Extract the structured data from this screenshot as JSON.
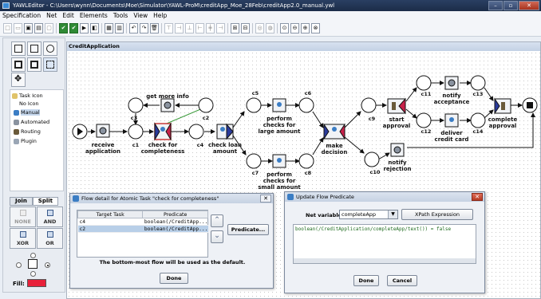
{
  "window": {
    "title": "YAWLEditor - C:\\Users\\wynn\\Documents\\Moe\\Simulator\\YAWL-ProM\\creditApp_Moe_28Feb\\creditApp2.0_manual.ywl"
  },
  "menu": [
    "Specification",
    "Net",
    "Edit",
    "Elements",
    "Tools",
    "View",
    "Help"
  ],
  "canvas": {
    "net_name": "CreditApplication"
  },
  "palette": {
    "tree": [
      "Task Icon",
      "No Icon",
      "Manual",
      "Automated",
      "Routing",
      "Plugin"
    ],
    "tabs": [
      "Join",
      "Split"
    ],
    "split_buttons": [
      "NONE",
      "AND",
      "XOR",
      "OR"
    ],
    "fill_label": "Fill:",
    "fill_color": "#e8213a"
  },
  "net": {
    "tasks": {
      "receive": "receive\napplication",
      "get_info": "get more info",
      "check": "check for\ncompleteness",
      "check_loan": "check loan\namount",
      "large": "perform\nchecks for\nlarge amount",
      "small": "perform\nchecks for\nsmall amount",
      "decision": "make\ndecision",
      "start": "start\napproval",
      "notify_acc": "notify\nacceptance",
      "card": "deliver\ncredit card",
      "complete": "complete\napproval",
      "notify_rej": "notify\nrejection"
    },
    "conditions": [
      "c1",
      "c2",
      "c3",
      "c4",
      "c5",
      "c6",
      "c7",
      "c8",
      "c9",
      "c10",
      "c11",
      "c12",
      "c13",
      "c14"
    ]
  },
  "flow_dialog": {
    "title": "Flow detail for Atomic Task \"check for completeness\"",
    "col_target": "Target Task",
    "col_predicate": "Predicate",
    "rows": [
      {
        "target": "c4",
        "predicate": "boolean(/CreditApp..."
      },
      {
        "target": "c2",
        "predicate": "boolean(/CreditApp..."
      }
    ],
    "predicate_button": "Predicate...",
    "note": "The bottom-most flow will be used as the default.",
    "done": "Done"
  },
  "predicate_dialog": {
    "title": "Update Flow Predicate",
    "net_variable_label": "Net variable:",
    "net_variable_value": "completeApp",
    "xpath_button": "XPath Expression",
    "expression": "boolean(/CreditApplication/completeApp/text()) = false",
    "done": "Done",
    "cancel": "Cancel"
  }
}
